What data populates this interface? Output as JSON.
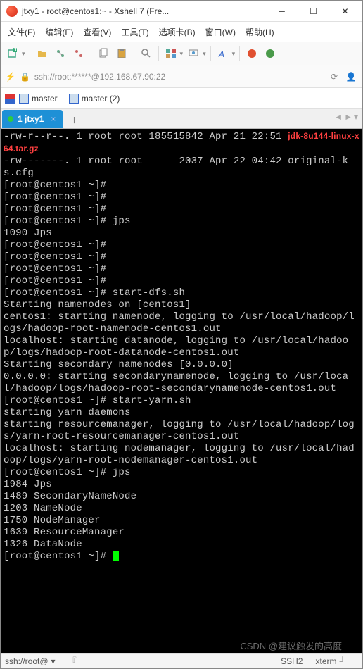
{
  "window": {
    "title": "jtxy1 - root@centos1:~ - Xshell 7 (Fre..."
  },
  "menu": {
    "file": "文件(F)",
    "edit": "编辑(E)",
    "view": "查看(V)",
    "tools": "工具(T)",
    "tabs": "选项卡(B)",
    "window": "窗口(W)",
    "help": "帮助(H)"
  },
  "addr": {
    "text": "ssh://root:******@192.168.67.90:22"
  },
  "sessions": {
    "s1": "master",
    "s2": "master (2)"
  },
  "tab": {
    "label": "1 jtxy1"
  },
  "status": {
    "left": "ssh://root@",
    "proto": "SSH2",
    "mode": "xterm",
    "watermark": "CSDN @建议触发的高度"
  },
  "lines": [
    {
      "t": "-rw-r--r--. 1 root root 185515842 Apr 21 22:51 "
    },
    {
      "t": "jdk-8u144-linux-x64.tar.gz",
      "cls": "red"
    },
    {
      "t": "-rw-------. 1 root root      2037 Apr 22 04:42 original-ks.cfg"
    },
    {
      "t": "[root@centos1 ~]#"
    },
    {
      "t": "[root@centos1 ~]#"
    },
    {
      "t": "[root@centos1 ~]#"
    },
    {
      "t": "[root@centos1 ~]# jps"
    },
    {
      "t": "1090 Jps"
    },
    {
      "t": "[root@centos1 ~]#"
    },
    {
      "t": "[root@centos1 ~]#"
    },
    {
      "t": "[root@centos1 ~]#"
    },
    {
      "t": "[root@centos1 ~]#"
    },
    {
      "t": "[root@centos1 ~]# start-dfs.sh"
    },
    {
      "t": "Starting namenodes on [centos1]"
    },
    {
      "t": "centos1: starting namenode, logging to /usr/local/hadoop/logs/hadoop-root-namenode-centos1.out"
    },
    {
      "t": "localhost: starting datanode, logging to /usr/local/hadoop/logs/hadoop-root-datanode-centos1.out"
    },
    {
      "t": "Starting secondary namenodes [0.0.0.0]"
    },
    {
      "t": "0.0.0.0: starting secondarynamenode, logging to /usr/local/hadoop/logs/hadoop-root-secondarynamenode-centos1.out"
    },
    {
      "t": "[root@centos1 ~]# start-yarn.sh"
    },
    {
      "t": "starting yarn daemons"
    },
    {
      "t": "starting resourcemanager, logging to /usr/local/hadoop/logs/yarn-root-resourcemanager-centos1.out"
    },
    {
      "t": "localhost: starting nodemanager, logging to /usr/local/hadoop/logs/yarn-root-nodemanager-centos1.out"
    },
    {
      "t": "[root@centos1 ~]# jps"
    },
    {
      "t": "1984 Jps"
    },
    {
      "t": "1489 SecondaryNameNode"
    },
    {
      "t": "1203 NameNode"
    },
    {
      "t": "1750 NodeManager"
    },
    {
      "t": "1639 ResourceManager"
    },
    {
      "t": "1326 DataNode"
    },
    {
      "t": "[root@centos1 ~]# ",
      "cursor": true
    }
  ]
}
